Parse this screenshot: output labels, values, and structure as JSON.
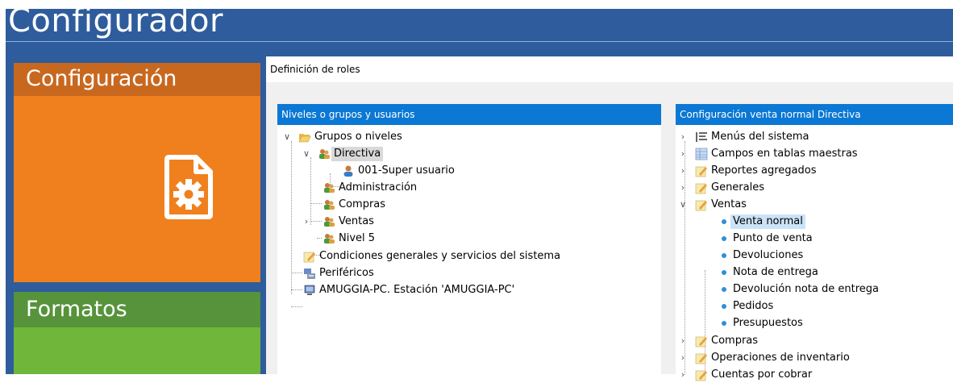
{
  "app": {
    "title": "Configurador",
    "tiles": [
      {
        "label": "Configuración",
        "color": "#f0801e"
      },
      {
        "label": "Formatos",
        "color": "#6fb63a"
      }
    ]
  },
  "dialog": {
    "title": "Definición de roles",
    "left_panel": {
      "header": "Niveles o grupos y usuarios",
      "tree": {
        "root": "Grupos o niveles",
        "directiva": "Directiva",
        "super_user": "001-Super usuario",
        "administracion": "Administración",
        "compras": "Compras",
        "ventas": "Ventas",
        "nivel5": "Nivel 5",
        "condiciones": "Condiciones generales y servicios del sistema",
        "perifericos": "Periféricos",
        "estacion": "AMUGGIA-PC. Estación 'AMUGGIA-PC'"
      }
    },
    "right_panel": {
      "header": "Configuración venta normal Directiva",
      "tree": {
        "menus": "Menús del sistema",
        "campos": "Campos en tablas maestras",
        "reportes": "Reportes agregados",
        "generales": "Generales",
        "ventas": "Ventas",
        "venta_normal": "Venta normal",
        "punto_venta": "Punto de venta",
        "devoluciones": "Devoluciones",
        "nota_entrega": "Nota de entrega",
        "devolucion_nota": "Devolución nota de entrega",
        "pedidos": "Pedidos",
        "presupuestos": "Presupuestos",
        "compras": "Compras",
        "operaciones": "Operaciones de inventario",
        "cuentas": "Cuentas por cobrar"
      }
    }
  },
  "colors": {
    "header_blue": "#2e5c9c",
    "panel_header_blue": "#0a78d4",
    "selected_row": "#cce3f7"
  }
}
